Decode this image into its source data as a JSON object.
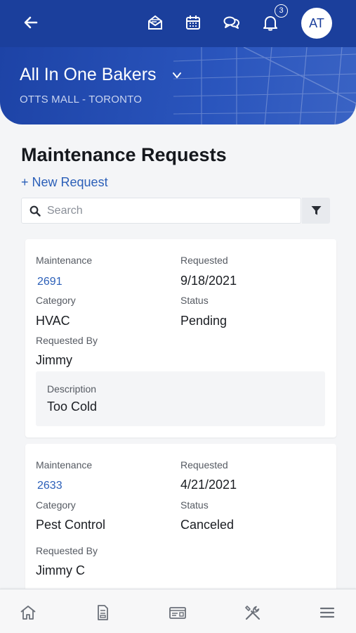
{
  "header": {
    "avatar_initials": "AT",
    "notification_count": "3",
    "icons": [
      "back-arrow-icon",
      "mail-open-icon",
      "calendar-icon",
      "chat-icon",
      "bell-icon"
    ]
  },
  "site": {
    "name": "All In One Bakers",
    "location": "OTTS MALL - TORONTO"
  },
  "page": {
    "title": "Maintenance Requests",
    "new_request_label": "+ New Request",
    "search_placeholder": "Search"
  },
  "requests": [
    {
      "maintenance_label": "Maintenance",
      "maintenance_id": "2691",
      "requested_label": "Requested",
      "requested_date": "9/18/2021",
      "category_label": "Category",
      "category": "HVAC",
      "status_label": "Status",
      "status": "Pending",
      "requested_by_label": "Requested By",
      "requested_by": "Jimmy",
      "description_label": "Description",
      "description": "Too Cold"
    },
    {
      "maintenance_label": "Maintenance",
      "maintenance_id": "2633",
      "requested_label": "Requested",
      "requested_date": "4/21/2021",
      "category_label": "Category",
      "category": "Pest Control",
      "status_label": "Status",
      "status": "Canceled",
      "requested_by_label": "Requested By",
      "requested_by": "Jimmy C"
    }
  ],
  "bottom_nav": [
    "home-icon",
    "document-icon",
    "ticket-icon",
    "tools-icon",
    "menu-icon"
  ],
  "colors": {
    "primary": "#1b3f9c",
    "link": "#2b5fb8",
    "background": "#f4f5f7"
  }
}
